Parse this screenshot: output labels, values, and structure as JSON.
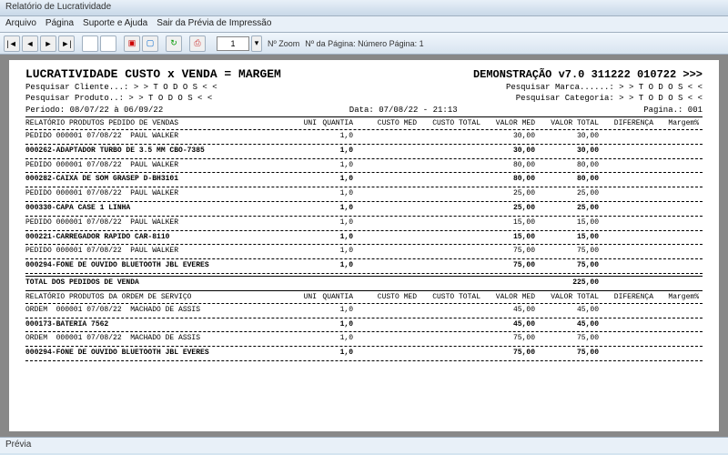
{
  "window": {
    "title": "Relatório de Lucratividade"
  },
  "menu": {
    "items": [
      "Arquivo",
      "Página",
      "Suporte e Ajuda",
      "Sair da Prévia de Impressão"
    ]
  },
  "toolbar": {
    "zoom_value": "1",
    "zoom_label": "Nº Zoom",
    "page_label": "Nº da Página: Número Página: 1"
  },
  "header": {
    "title_left": "LUCRATIVIDADE CUSTO x VENDA = MARGEM",
    "title_right": "DEMONSTRAÇÃO v7.0 311222 010722 >>>",
    "search_client": "Pesquisar Cliente...: > >  T O D O S  < <",
    "search_brand": "Pesquisar Marca......: > >  T O D O S  < <",
    "search_product": "Pesquisar Produto..: > >  T O D O S  < <",
    "search_category": "Pesquisar Categoria: > >  T O D O S  < <",
    "period": "Período: 08/07/22 à 06/09/22",
    "date": "Data: 07/08/22 - 21:13",
    "pagina": "Pagina.: 001"
  },
  "columns1": {
    "c1": "RELATÓRIO PRODUTOS PEDIDO DE VENDAS",
    "c2": "UNI",
    "c3": "QUANTIA",
    "c4": "CUSTO MED",
    "c5": "CUSTO TOTAL",
    "c6": "VALOR MED",
    "c7": "VALOR TOTAL",
    "c8": "DIFERENÇA",
    "c9": "Margem%"
  },
  "rows1": [
    {
      "c1": "PEDIDO 000001 07/08/22  PAUL WALKER",
      "c3": "1,0",
      "c6": "30,00",
      "c7": "30,00",
      "bold": false
    },
    {
      "c1": "000262-ADAPTADOR TURBO DE 3.5 MM CBO-7385",
      "c3": "1,0",
      "c6": "30,00",
      "c7": "30,00",
      "bold": true
    },
    {
      "c1": "PEDIDO 000001 07/08/22  PAUL WALKER",
      "c3": "1,0",
      "c6": "80,00",
      "c7": "80,00",
      "bold": false
    },
    {
      "c1": "000282-CAIXA DE SOM GRASEP D-BH3101",
      "c3": "1,0",
      "c6": "80,00",
      "c7": "80,00",
      "bold": true
    },
    {
      "c1": "PEDIDO 000001 07/08/22  PAUL WALKER",
      "c3": "1,0",
      "c6": "25,00",
      "c7": "25,00",
      "bold": false
    },
    {
      "c1": "000330-CAPA CASE 1 LINHA",
      "c3": "1,0",
      "c6": "25,00",
      "c7": "25,00",
      "bold": true
    },
    {
      "c1": "PEDIDO 000001 07/08/22  PAUL WALKER",
      "c3": "1,0",
      "c6": "15,00",
      "c7": "15,00",
      "bold": false
    },
    {
      "c1": "000221-CARREGADOR RAPIDO CAR-8110",
      "c3": "1,0",
      "c6": "15,00",
      "c7": "15,00",
      "bold": true
    },
    {
      "c1": "PEDIDO 000001 07/08/22  PAUL WALKER",
      "c3": "1,0",
      "c6": "75,00",
      "c7": "75,00",
      "bold": false
    },
    {
      "c1": "000294-FONE DE OUVIDO BLUETOOTH JBL EVERES",
      "c3": "1,0",
      "c6": "75,00",
      "c7": "75,00",
      "bold": true
    }
  ],
  "total1": {
    "label": "TOTAL DOS PEDIDOS DE VENDA",
    "value": "225,00"
  },
  "columns2": {
    "c1": "RELATÓRIO PRODUTOS DA ORDEM DE SERVIÇO",
    "c2": "UNI",
    "c3": "QUANTIA",
    "c4": "CUSTO MED",
    "c5": "CUSTO TOTAL",
    "c6": "VALOR MED",
    "c7": "VALOR TOTAL",
    "c8": "DIFERENÇA",
    "c9": "Margem%"
  },
  "rows2": [
    {
      "c1": "ORDEM  000001 07/08/22  MACHADO DE ASSIS",
      "c3": "1,0",
      "c6": "45,00",
      "c7": "45,00",
      "bold": false
    },
    {
      "c1": "000173-BATERIA 7562",
      "c3": "1,0",
      "c6": "45,00",
      "c7": "45,00",
      "bold": true
    },
    {
      "c1": "ORDEM  000001 07/08/22  MACHADO DE ASSIS",
      "c3": "1,0",
      "c6": "75,00",
      "c7": "75,00",
      "bold": false
    },
    {
      "c1": "000294-FONE DE OUVIDO BLUETOOTH JBL EVERES",
      "c3": "1,0",
      "c6": "75,00",
      "c7": "75,00",
      "bold": true
    }
  ],
  "status": {
    "label": "Prévia"
  }
}
